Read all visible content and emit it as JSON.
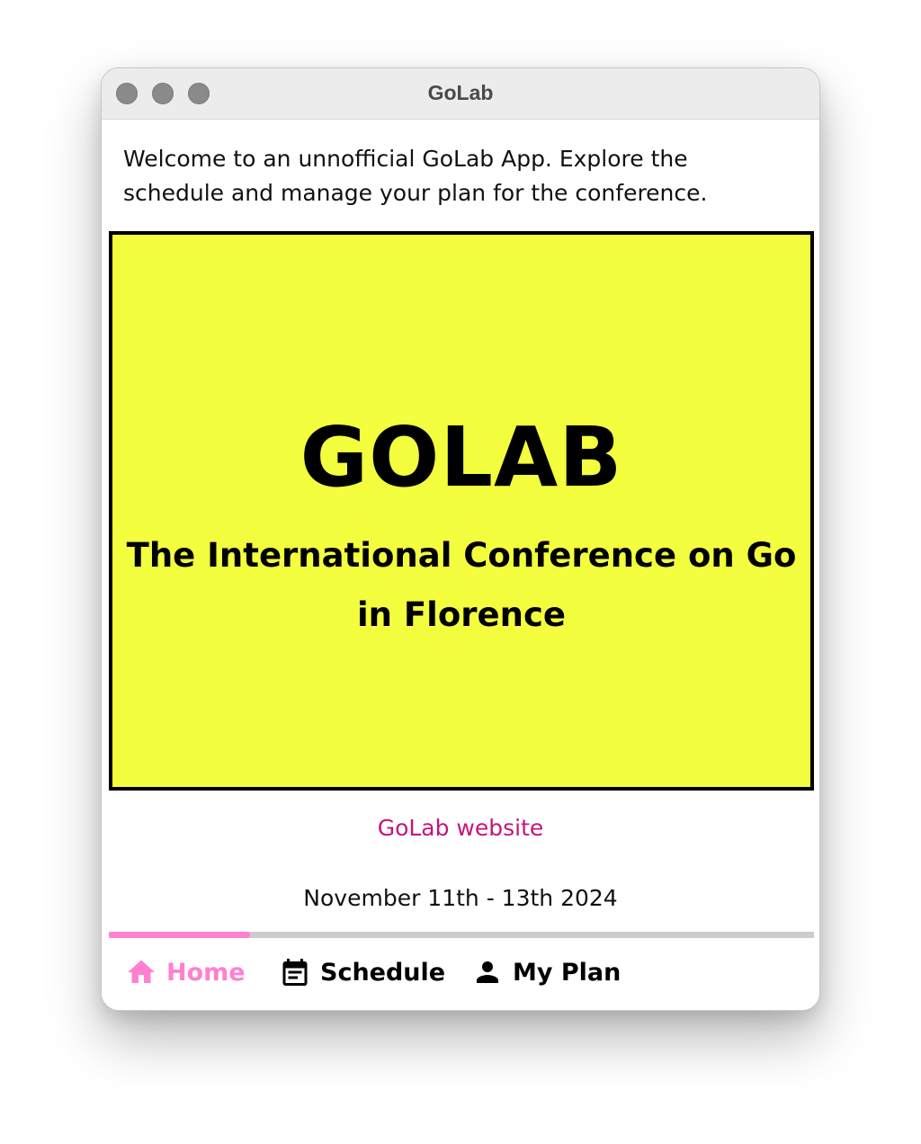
{
  "window": {
    "title": "GoLab"
  },
  "intro": {
    "text": "Welcome to an unnofficial GoLab App. Explore the schedule and manage your plan for the conference."
  },
  "banner": {
    "title": "GOLAB",
    "subtitle": "The International Conference on Go in Florence",
    "background_color": "#f3ff3e"
  },
  "links": {
    "website_label": "GoLab website",
    "link_color": "#c5157a"
  },
  "event": {
    "dates": "November 11th - 13th 2024"
  },
  "tab_indicator": {
    "active_fraction": 0.2
  },
  "nav": {
    "active_color": "#ff80d0",
    "items": [
      {
        "label": "Home",
        "icon": "home-icon",
        "active": true
      },
      {
        "label": "Schedule",
        "icon": "calendar-icon",
        "active": false
      },
      {
        "label": "My Plan",
        "icon": "person-icon",
        "active": false
      }
    ]
  }
}
